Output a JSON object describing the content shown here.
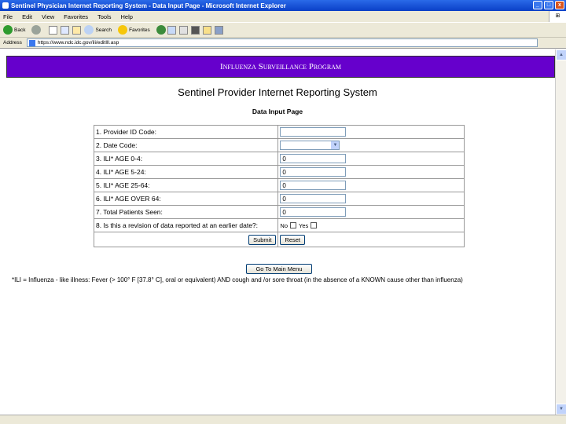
{
  "window": {
    "title": "Sentinel Physician Internet Reporting System - Data Input Page - Microsoft Internet Explorer",
    "minimize": "_",
    "maximize": "□",
    "close": "x"
  },
  "menu": {
    "items": [
      "File",
      "Edit",
      "View",
      "Favorites",
      "Tools",
      "Help"
    ]
  },
  "toolbar": {
    "back_label": "Back",
    "search_label": "Search",
    "favorites_label": "Favorites"
  },
  "address": {
    "label": "Address",
    "url": "https://www.ndc.idc.gov/ili/editIll.asp"
  },
  "page": {
    "banner": "Influenza Surveillance Program",
    "title": "Sentinel Provider Internet Reporting System",
    "subtitle": "Data Input Page",
    "fields": [
      {
        "label": "1. Provider ID Code:",
        "value": ""
      },
      {
        "label": "2. Date Code:",
        "value": ""
      },
      {
        "label": "3. ILI* AGE 0-4:",
        "value": "0"
      },
      {
        "label": "4. ILI* AGE 5-24:",
        "value": "0"
      },
      {
        "label": "5. ILI* AGE 25-64:",
        "value": "0"
      },
      {
        "label": "6. ILI* AGE OVER 64:",
        "value": "0"
      },
      {
        "label": "7. Total Patients Seen:",
        "value": "0"
      }
    ],
    "revision": {
      "label": "8. Is this a revision of data reported at an earlier date?:",
      "no": "No",
      "yes": "Yes"
    },
    "submit_label": "Submit",
    "reset_label": "Reset",
    "main_menu_label": "Go To Main Menu",
    "footnote": "*ILI = Influenza - like illness: Fever (> 100° F [37.8° C], oral or equivalent) AND cough and /or sore throat (in the absence of a KNOWN cause other than influenza)"
  }
}
